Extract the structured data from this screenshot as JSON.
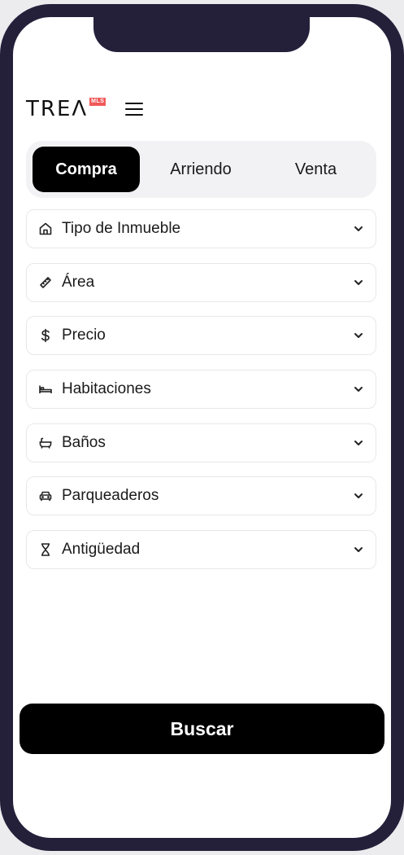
{
  "logo": {
    "text": "TREΛ",
    "badge": "MLS",
    "badge_color": "#f15a5a"
  },
  "tabs": [
    {
      "label": "Compra",
      "selected": true
    },
    {
      "label": "Arriendo",
      "selected": false
    },
    {
      "label": "Venta",
      "selected": false
    }
  ],
  "filters": [
    {
      "label": "Tipo de Inmueble",
      "icon": "home-icon"
    },
    {
      "label": "Área",
      "icon": "ruler-icon"
    },
    {
      "label": "Precio",
      "icon": "dollar-icon"
    },
    {
      "label": "Habitaciones",
      "icon": "bed-icon"
    },
    {
      "label": "Baños",
      "icon": "bathtub-icon"
    },
    {
      "label": "Parqueaderos",
      "icon": "car-icon"
    },
    {
      "label": "Antigüedad",
      "icon": "hourglass-icon"
    }
  ],
  "search_button": {
    "label": "Buscar"
  },
  "colors": {
    "frame": "#24203a",
    "primary": "#000000",
    "tab_track": "#f2f2f4"
  }
}
